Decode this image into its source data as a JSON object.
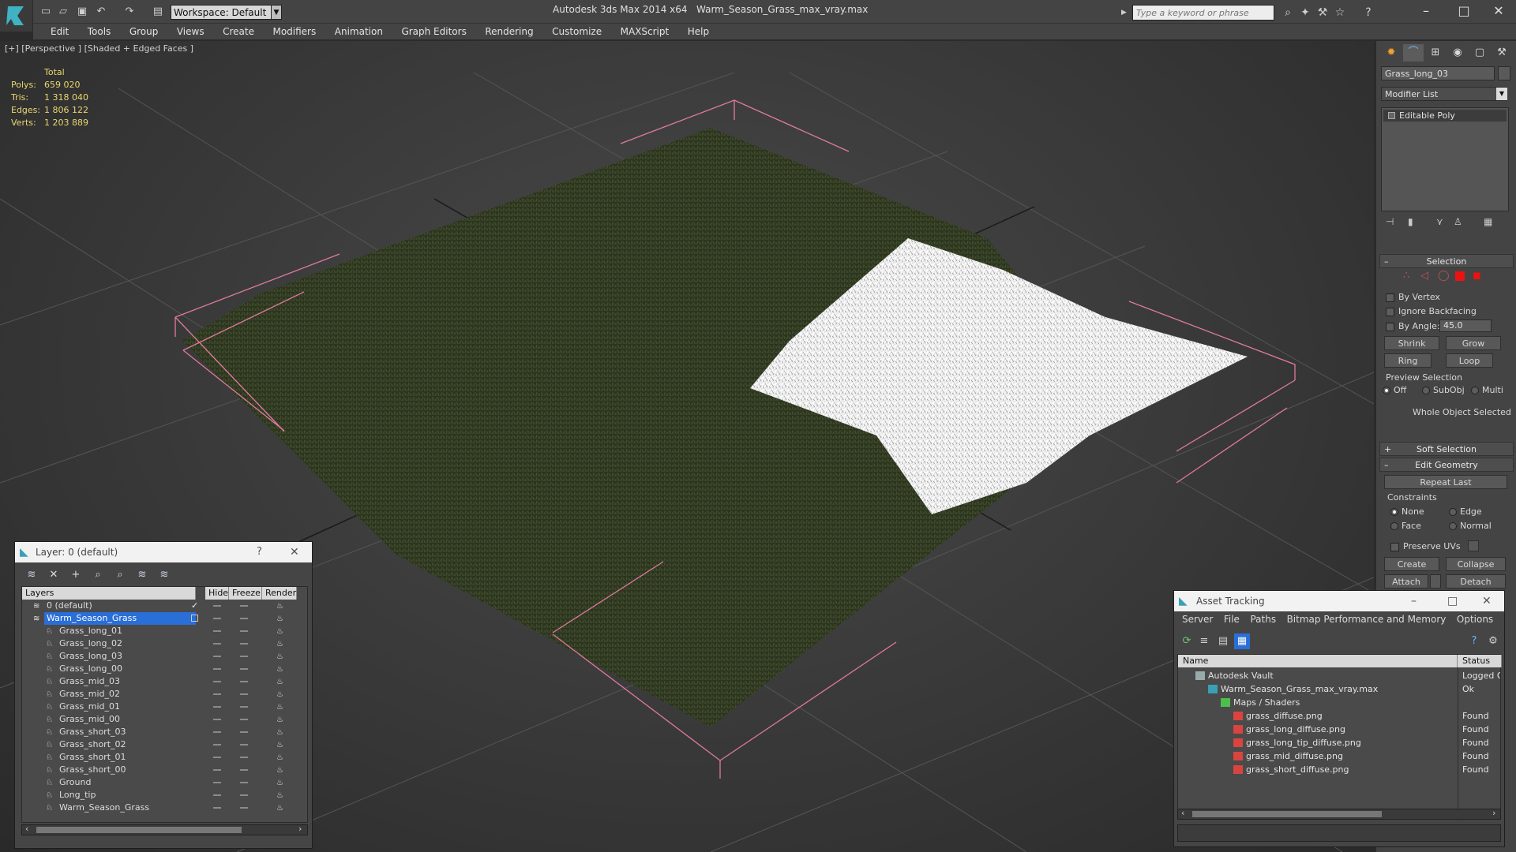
{
  "app": {
    "title": "Autodesk 3ds Max 2014 x64",
    "file": "Warm_Season_Grass_max_vray.max",
    "workspace": "Workspace: Default",
    "search_placeholder": "Type a keyword or phrase"
  },
  "menu": [
    "Edit",
    "Tools",
    "Group",
    "Views",
    "Create",
    "Modifiers",
    "Animation",
    "Graph Editors",
    "Rendering",
    "Customize",
    "MAXScript",
    "Help"
  ],
  "viewport": {
    "label": "[+] [Perspective ] [Shaded + Edged Faces ]",
    "stats_header": "Total",
    "stats": [
      {
        "label": "Polys:",
        "value": "659 020"
      },
      {
        "label": "Tris:",
        "value": "1 318 040"
      },
      {
        "label": "Edges:",
        "value": "1 806 122"
      },
      {
        "label": "Verts:",
        "value": "1 203 889"
      }
    ]
  },
  "command_panel": {
    "object_name": "Grass_long_03",
    "modifier_list": "Modifier List",
    "stack_item": "Editable Poly",
    "selection": {
      "title": "Selection",
      "by_vertex": "By Vertex",
      "ignore_backfacing": "Ignore Backfacing",
      "by_angle": "By Angle:",
      "angle_value": "45.0",
      "shrink": "Shrink",
      "grow": "Grow",
      "ring": "Ring",
      "loop": "Loop",
      "preview_selection": "Preview Selection",
      "preview_off": "Off",
      "preview_subobj": "SubObj",
      "preview_multi": "Multi",
      "whole_object": "Whole Object Selected"
    },
    "soft_selection": "Soft Selection",
    "edit_geometry": {
      "title": "Edit Geometry",
      "repeat_last": "Repeat Last",
      "constraints": "Constraints",
      "none": "None",
      "edge": "Edge",
      "face": "Face",
      "normal": "Normal",
      "preserve_uvs": "Preserve UVs",
      "create": "Create",
      "collapse": "Collapse",
      "attach": "Attach",
      "detach": "Detach"
    }
  },
  "layer_window": {
    "title": "Layer: 0 (default)",
    "help": "?",
    "columns": [
      "Layers",
      "Hide",
      "Freeze",
      "Render"
    ],
    "layers": [
      {
        "name": "0 (default)",
        "level": 0
      },
      {
        "name": "Warm_Season_Grass",
        "level": 0
      },
      {
        "name": "Grass_long_01",
        "level": 1
      },
      {
        "name": "Grass_long_02",
        "level": 1
      },
      {
        "name": "Grass_long_03",
        "level": 1
      },
      {
        "name": "Grass_long_00",
        "level": 1
      },
      {
        "name": "Grass_mid_03",
        "level": 1
      },
      {
        "name": "Grass_mid_02",
        "level": 1
      },
      {
        "name": "Grass_mid_01",
        "level": 1
      },
      {
        "name": "Grass_mid_00",
        "level": 1
      },
      {
        "name": "Grass_short_03",
        "level": 1
      },
      {
        "name": "Grass_short_02",
        "level": 1
      },
      {
        "name": "Grass_short_01",
        "level": 1
      },
      {
        "name": "Grass_short_00",
        "level": 1
      },
      {
        "name": "Ground",
        "level": 1
      },
      {
        "name": "Long_tip",
        "level": 1
      },
      {
        "name": "Warm_Season_Grass",
        "level": 1
      }
    ]
  },
  "asset_window": {
    "title": "Asset Tracking",
    "menu": [
      "Server",
      "File",
      "Paths",
      "Bitmap Performance and Memory",
      "Options"
    ],
    "columns": [
      "Name",
      "Status"
    ],
    "rows": [
      {
        "name": "Autodesk Vault",
        "status": "Logged O",
        "level": 0,
        "icon": "vault"
      },
      {
        "name": "Warm_Season_Grass_max_vray.max",
        "status": "Ok",
        "level": 1,
        "icon": "max"
      },
      {
        "name": "Maps / Shaders",
        "status": "",
        "level": 2,
        "icon": "folder"
      },
      {
        "name": "grass_diffuse.png",
        "status": "Found",
        "level": 3,
        "icon": "png"
      },
      {
        "name": "grass_long_diffuse.png",
        "status": "Found",
        "level": 3,
        "icon": "png"
      },
      {
        "name": "grass_long_tip_diffuse.png",
        "status": "Found",
        "level": 3,
        "icon": "png"
      },
      {
        "name": "grass_mid_diffuse.png",
        "status": "Found",
        "level": 3,
        "icon": "png"
      },
      {
        "name": "grass_short_diffuse.png",
        "status": "Found",
        "level": 3,
        "icon": "png"
      }
    ]
  },
  "colors": {
    "stats": "#e9d770",
    "selection_blue": "#2a6ed8",
    "grass_dark": "#2f3a22",
    "grass_white": "#f4f4f4",
    "bbox_pink": "#e07aa0"
  }
}
